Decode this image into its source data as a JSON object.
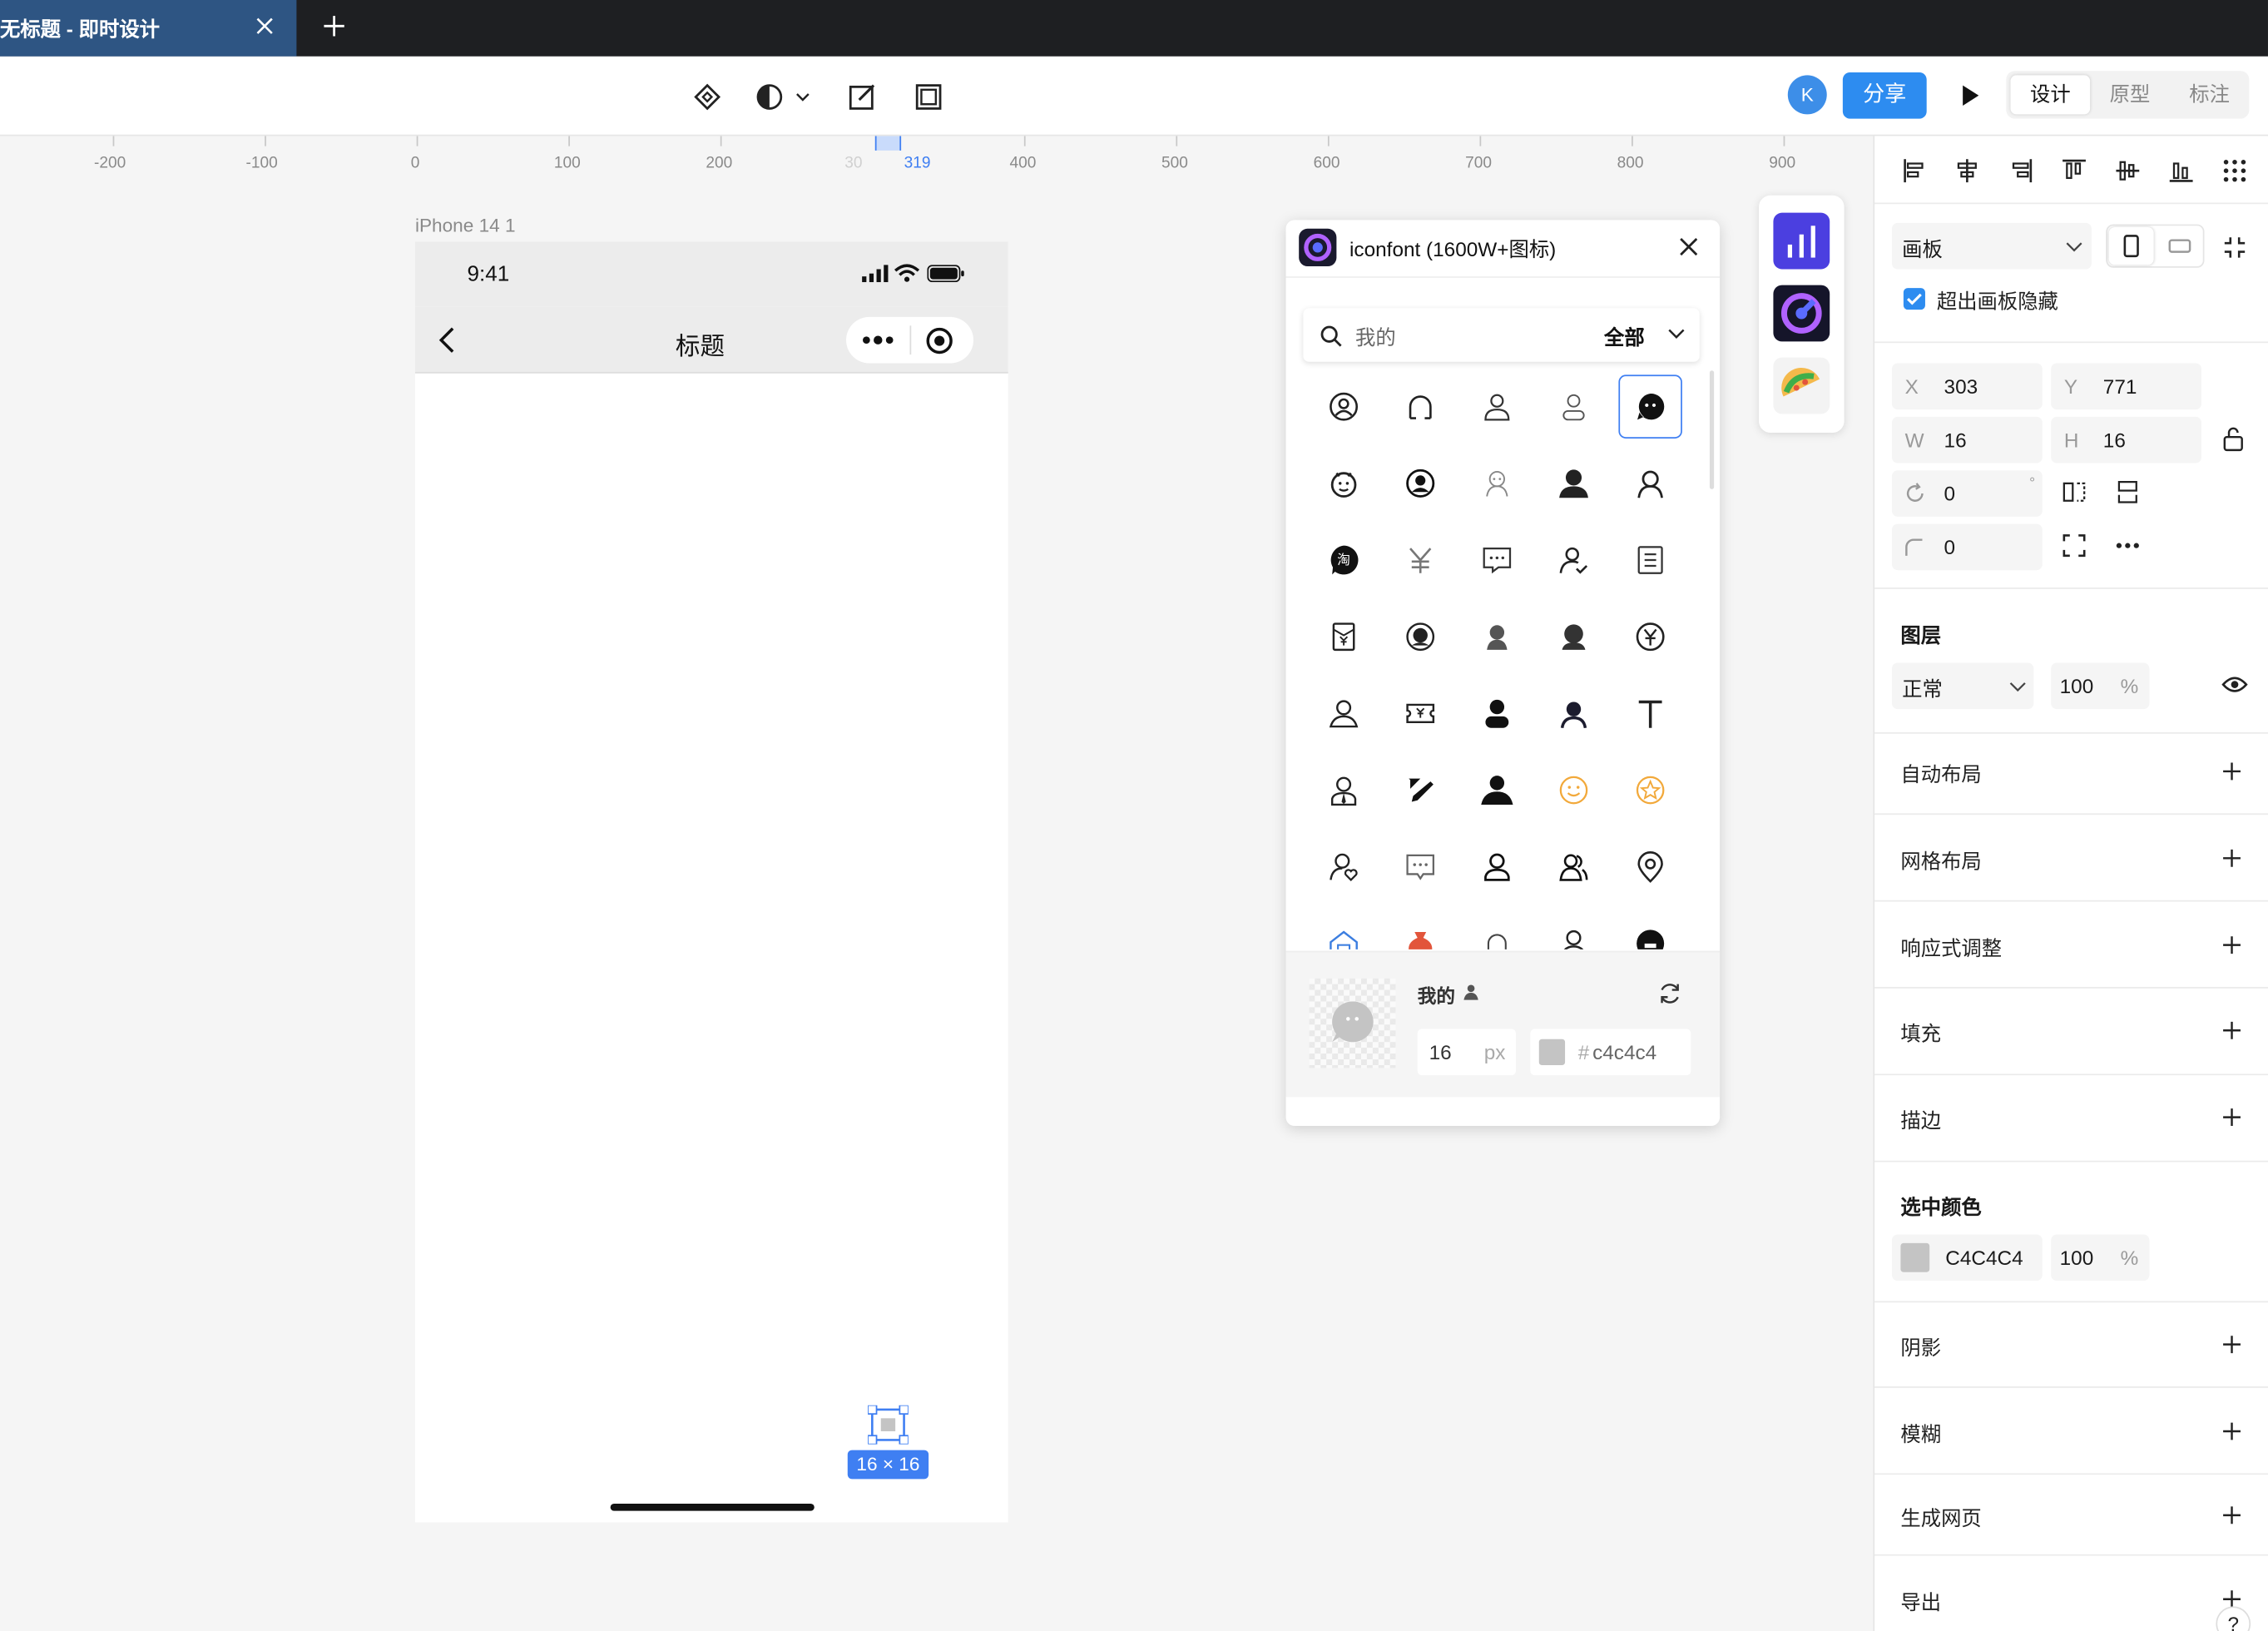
{
  "tab": {
    "title": "无标题 - 即时设计"
  },
  "toolbar": {
    "avatar_letter": "K",
    "share_label": "分享",
    "modes": [
      "设计",
      "原型",
      "标注"
    ],
    "active_mode": "设计"
  },
  "ruler": {
    "labels": [
      "-200",
      "-100",
      "0",
      "100",
      "200",
      "30",
      "319",
      "400",
      "500",
      "600",
      "700",
      "800",
      "900"
    ]
  },
  "frame": {
    "label": "iPhone 14 1",
    "time": "9:41",
    "nav_title": "标题"
  },
  "selection": {
    "size_tag": "16 × 16"
  },
  "iconfont": {
    "title": "iconfont (1600W+图标)",
    "search_text": "我的",
    "scope": "全部",
    "footer_label": "我的",
    "size_value": "16",
    "size_unit": "px",
    "color_hash": "#",
    "color_value": "c4c4c4",
    "color": "#c4c4c4"
  },
  "inspector": {
    "frame_type": "画板",
    "clip_label": "超出画板隐藏",
    "x_label": "X",
    "x": "303",
    "y_label": "Y",
    "y": "771",
    "w_label": "W",
    "w": "16",
    "h_label": "H",
    "h": "16",
    "rotation": "0",
    "rotation_unit": "°",
    "radius": "0",
    "layer_title": "图层",
    "blend": "正常",
    "opacity": "100",
    "percent": "%",
    "sections": [
      "自动布局",
      "网格布局",
      "响应式调整",
      "填充",
      "描边"
    ],
    "selected_color_title": "选中颜色",
    "selected_color_hex": "C4C4C4",
    "selected_color_swatch": "#c4c4c4",
    "selected_color_opacity": "100",
    "sections2": [
      "阴影",
      "模糊",
      "生成网页",
      "导出"
    ],
    "help": "?"
  }
}
